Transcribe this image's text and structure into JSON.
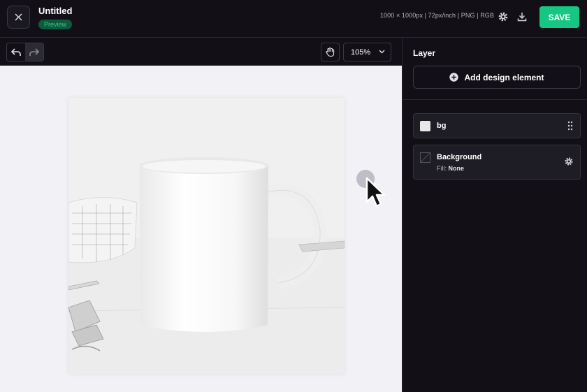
{
  "document": {
    "title": "Untitled",
    "badge": "Preview",
    "meta": "1000 × 1000px  |  72px/inch  |  PNG  |  RGB"
  },
  "toolbar": {
    "save_label": "SAVE",
    "zoom": "105%"
  },
  "panel": {
    "title": "Layer",
    "add_label": "Add design element",
    "layers": [
      {
        "name": "bg"
      },
      {
        "name": "Background",
        "fill_label": "Fill:",
        "fill_value": "None"
      }
    ]
  },
  "colors": {
    "accent": "#16c784",
    "background": "#121016",
    "canvas": "#f2f1f6"
  },
  "icons": [
    "close-icon",
    "gear-icon",
    "download-icon",
    "undo-icon",
    "redo-icon",
    "hand-icon",
    "chevron-down-icon",
    "plus-circle-icon",
    "drag-handle-icon",
    "cursor-icon"
  ]
}
